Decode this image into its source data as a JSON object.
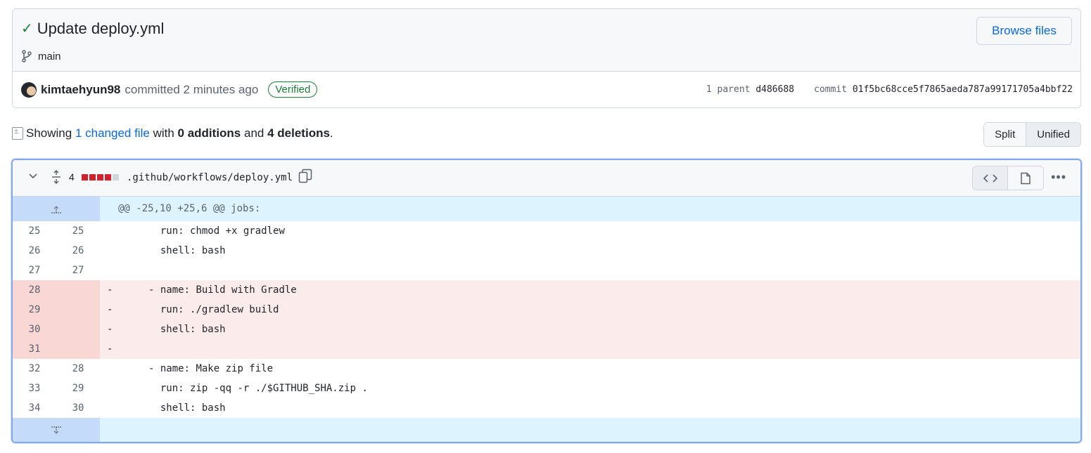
{
  "commit": {
    "title": "Update deploy.yml",
    "branch": "main",
    "browse_label": "Browse files",
    "author": "kimtaehyun98",
    "committed_text": "committed 2 minutes ago",
    "verified": "Verified",
    "parent_label": "1 parent",
    "parent_sha": "d486688",
    "commit_label": "commit",
    "commit_sha": "01f5bc68cce5f7865aeda787a99171705a4bbf22"
  },
  "summary": {
    "showing": "Showing",
    "changed_link": "1 changed file",
    "with": "with",
    "additions": "0 additions",
    "and": "and",
    "deletions": "4 deletions",
    "period": "."
  },
  "view_toggle": {
    "split": "Split",
    "unified": "Unified"
  },
  "file": {
    "change_count": "4",
    "path": ".github/workflows/deploy.yml",
    "hunk_header": "@@ -25,10 +25,6 @@ jobs:",
    "lines": [
      {
        "old": "25",
        "new": "25",
        "sign": " ",
        "text": "        run: chmod +x gradlew",
        "type": "ctx"
      },
      {
        "old": "26",
        "new": "26",
        "sign": " ",
        "text": "        shell: bash",
        "type": "ctx"
      },
      {
        "old": "27",
        "new": "27",
        "sign": " ",
        "text": "",
        "type": "ctx"
      },
      {
        "old": "28",
        "new": "",
        "sign": "-",
        "text": "      - name: Build with Gradle",
        "type": "del"
      },
      {
        "old": "29",
        "new": "",
        "sign": "-",
        "text": "        run: ./gradlew build",
        "type": "del"
      },
      {
        "old": "30",
        "new": "",
        "sign": "-",
        "text": "        shell: bash",
        "type": "del"
      },
      {
        "old": "31",
        "new": "",
        "sign": "-",
        "text": "",
        "type": "del"
      },
      {
        "old": "32",
        "new": "28",
        "sign": " ",
        "text": "      - name: Make zip file",
        "type": "ctx"
      },
      {
        "old": "33",
        "new": "29",
        "sign": " ",
        "text": "        run: zip -qq -r ./$GITHUB_SHA.zip .",
        "type": "ctx"
      },
      {
        "old": "34",
        "new": "30",
        "sign": " ",
        "text": "        shell: bash",
        "type": "ctx"
      }
    ]
  },
  "icons": {
    "check": "check-icon",
    "branch": "git-branch-icon",
    "chevron": "chevron-down-icon",
    "expand": "unfold-icon",
    "copy": "copy-icon",
    "code": "code-icon",
    "file": "file-icon",
    "kebab": "kebab-horizontal-icon",
    "expand_up": "expand-up-icon",
    "expand_down": "expand-down-icon"
  },
  "colors": {
    "accent": "#0969da",
    "success": "#1a7f37",
    "deletion": "#cf222e",
    "deletion_bg": "#fbebea",
    "hunk_bg": "#ddf4ff"
  }
}
